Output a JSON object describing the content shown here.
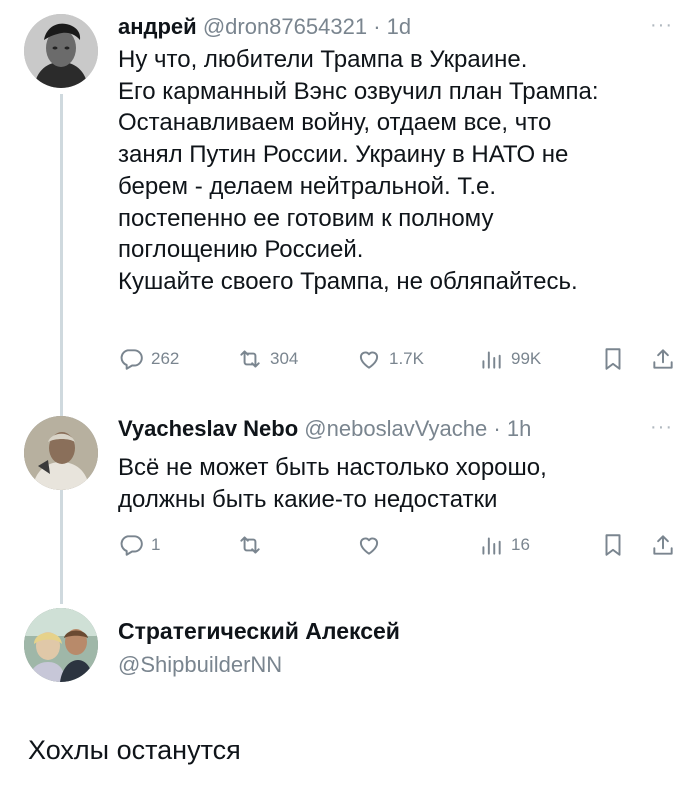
{
  "tweets": [
    {
      "name": "андрей",
      "handle": "@dron87654321",
      "time": "· 1d",
      "more": "···",
      "lines": [
        "Ну что, любители Трампа в Украине.",
        "Его карманный Вэнс озвучил план Трампа:",
        "Останавливаем войну, отдаем все, что",
        "занял Путин России. Украину в НАТО не",
        "берем - делаем нейтральной. Т.е.",
        "постепенно ее готовим к полному",
        "поглощению Россией.",
        "Кушайте своего Трампа, не обляпайтесь."
      ],
      "stats": {
        "replies": "262",
        "reposts": "304",
        "likes": "1.7K",
        "views": "99K"
      }
    },
    {
      "name": "Vyacheslav Nebo",
      "handle": "@neboslavVyache",
      "time": "· 1h",
      "more": "···",
      "lines": [
        "Всё не может быть настолько хорошо,",
        "должны быть какие-то недостатки"
      ],
      "stats": {
        "replies": "1",
        "reposts": "",
        "likes": "",
        "views": "16"
      }
    }
  ],
  "reply_card": {
    "name": "Стратегический Алексей",
    "handle": "@ShipbuilderNN"
  },
  "reply_text": "Хохлы останутся",
  "colors": {
    "text": "#0f1419",
    "muted": "#7a858f",
    "line": "#cfd9de"
  },
  "icons": [
    "reply-icon",
    "repost-icon",
    "like-icon",
    "views-icon",
    "bookmark-icon",
    "share-icon"
  ]
}
